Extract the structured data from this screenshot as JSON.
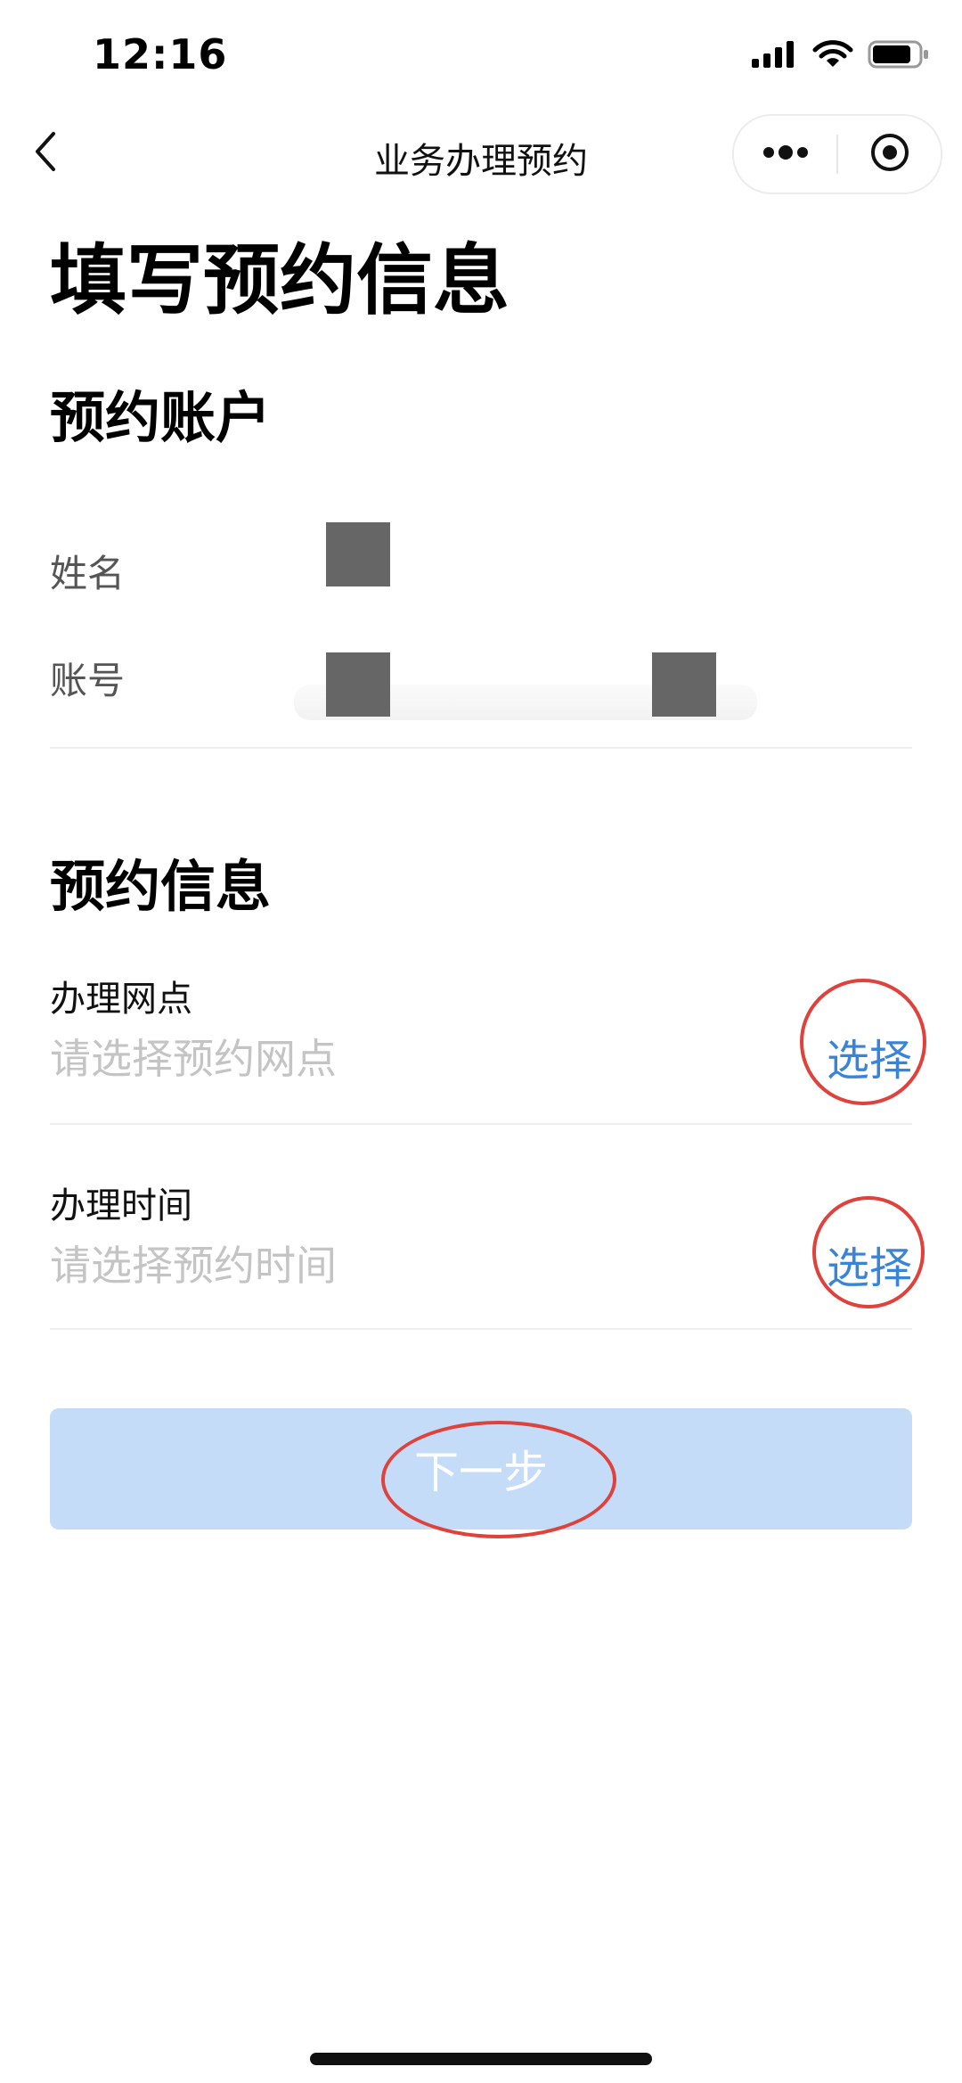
{
  "status_bar": {
    "time": "12:16"
  },
  "nav": {
    "title": "业务办理预约"
  },
  "page": {
    "title": "填写预约信息"
  },
  "account_section": {
    "title": "预约账户",
    "name_label": "姓名",
    "account_label": "账号"
  },
  "booking_section": {
    "title": "预约信息",
    "branch": {
      "label": "办理网点",
      "placeholder": "请选择预约网点",
      "action": "选择"
    },
    "time": {
      "label": "办理时间",
      "placeholder": "请选择预约时间",
      "action": "选择"
    }
  },
  "next_button": {
    "label": "下一步"
  },
  "colors": {
    "accent": "#3a84d8",
    "button_bg": "#c5dcf8",
    "annotation": "#e0413b"
  }
}
